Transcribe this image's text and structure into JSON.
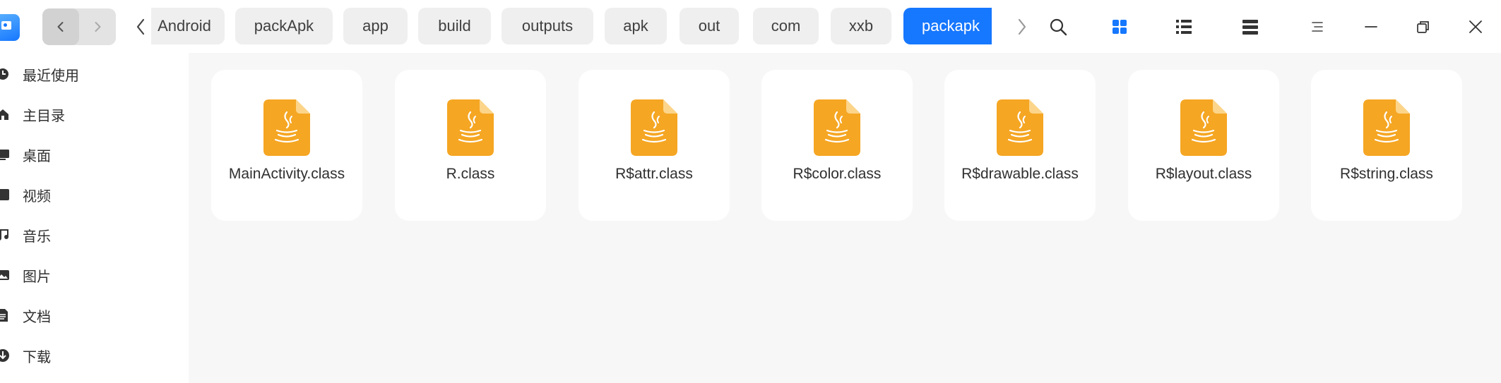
{
  "window": {
    "breadcrumbs": [
      "Android",
      "packApk",
      "app",
      "build",
      "outputs",
      "apk",
      "out",
      "com",
      "xxb",
      "packapk"
    ],
    "active_crumb": "packapk"
  },
  "toolbar": {
    "icons": [
      "back-arrow-icon",
      "forward-arrow-icon",
      "search-icon",
      "grid-view-icon",
      "list-view-icon",
      "tree-view-icon",
      "menu-icon",
      "minimize-icon",
      "restore-icon",
      "close-icon"
    ]
  },
  "sidebar": {
    "items": [
      {
        "label": "最近使用",
        "icon": "clock-icon"
      },
      {
        "label": "主目录",
        "icon": "home-icon"
      },
      {
        "label": "桌面",
        "icon": "desktop-icon"
      },
      {
        "label": "视频",
        "icon": "video-icon"
      },
      {
        "label": "音乐",
        "icon": "music-icon"
      },
      {
        "label": "图片",
        "icon": "picture-icon"
      },
      {
        "label": "文档",
        "icon": "document-icon"
      },
      {
        "label": "下载",
        "icon": "download-icon"
      }
    ]
  },
  "files": [
    {
      "name": "MainActivity.class",
      "icon": "java-file-icon"
    },
    {
      "name": "R.class",
      "icon": "java-file-icon"
    },
    {
      "name": "R$attr.class",
      "icon": "java-file-icon"
    },
    {
      "name": "R$color.class",
      "icon": "java-file-icon"
    },
    {
      "name": "R$drawable.class",
      "icon": "java-file-icon"
    },
    {
      "name": "R$layout.class",
      "icon": "java-file-icon"
    },
    {
      "name": "R$string.class",
      "icon": "java-file-icon"
    }
  ],
  "colors": {
    "accent": "#1677ff",
    "file_icon": "#f5a623",
    "background": "#f7f7f7"
  }
}
